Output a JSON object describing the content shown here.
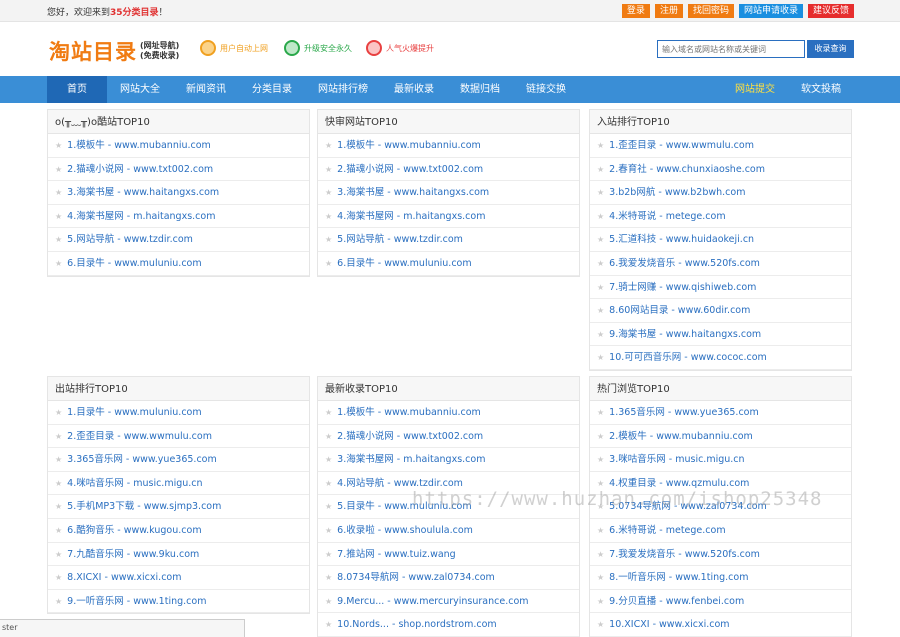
{
  "topbar": {
    "welcome_prefix": "您好，欢迎来到",
    "welcome_brand": "35分类目录",
    "welcome_suffix": "！",
    "links": [
      {
        "label": "登录",
        "color": "orange"
      },
      {
        "label": "注册",
        "color": "orange"
      },
      {
        "label": "找回密码",
        "color": "orange"
      },
      {
        "label": "网站申请收录",
        "color": "blue"
      },
      {
        "label": "建议反馈",
        "color": "red"
      }
    ]
  },
  "header": {
    "logo_main": "淘站目录",
    "logo_sub1": "(网址导航)",
    "logo_sub2": "(免费收录)",
    "features": [
      "用户自动上网",
      "升级安全永久",
      "人气火爆提升"
    ],
    "search_placeholder": "输入域名或网站名称或关键词",
    "search_button": "收录查询"
  },
  "nav": {
    "items": [
      "首页",
      "网站大全",
      "新闻资讯",
      "分类目录",
      "网站排行榜",
      "最新收录",
      "数据归档",
      "链接交换"
    ],
    "right": [
      "网站提交",
      "软文投稿"
    ]
  },
  "panels": [
    {
      "title": "o(╥﹏╥)o酷站TOP10",
      "rows": [
        {
          "name": "1.模板牛",
          "url": "www.mubanniu.com"
        },
        {
          "name": "2.猫魂小说网",
          "url": "www.txt002.com"
        },
        {
          "name": "3.海棠书屋",
          "url": "www.haitangxs.com"
        },
        {
          "name": "4.海棠书屋网",
          "url": "m.haitangxs.com"
        },
        {
          "name": "5.网站导航",
          "url": "www.tzdir.com"
        },
        {
          "name": "6.目录牛",
          "url": "www.muluniu.com"
        }
      ]
    },
    {
      "title": "快审网站TOP10",
      "rows": [
        {
          "name": "1.模板牛",
          "url": "www.mubanniu.com"
        },
        {
          "name": "2.猫魂小说网",
          "url": "www.txt002.com"
        },
        {
          "name": "3.海棠书屋",
          "url": "www.haitangxs.com"
        },
        {
          "name": "4.海棠书屋网",
          "url": "m.haitangxs.com"
        },
        {
          "name": "5.网站导航",
          "url": "www.tzdir.com"
        },
        {
          "name": "6.目录牛",
          "url": "www.muluniu.com"
        }
      ]
    },
    {
      "title": "入站排行TOP10",
      "rows": [
        {
          "name": "1.歪歪目录",
          "url": "www.wwmulu.com"
        },
        {
          "name": "2.春育社",
          "url": "www.chunxiaoshe.com"
        },
        {
          "name": "3.b2b网航",
          "url": "www.b2bwh.com"
        },
        {
          "name": "4.米特哥说",
          "url": "metege.com"
        },
        {
          "name": "5.汇道科技",
          "url": "www.huidaokeji.cn"
        },
        {
          "name": "6.我爱发烧音乐",
          "url": "www.520fs.com"
        },
        {
          "name": "7.骑士网赚",
          "url": "www.qishiweb.com"
        },
        {
          "name": "8.60网站目录",
          "url": "www.60dir.com"
        },
        {
          "name": "9.海棠书屋",
          "url": "www.haitangxs.com"
        },
        {
          "name": "10.可可西音乐网",
          "url": "www.cococ.com"
        }
      ]
    },
    {
      "title": "出站排行TOP10",
      "rows": [
        {
          "name": "1.目录牛",
          "url": "www.muluniu.com"
        },
        {
          "name": "2.歪歪目录",
          "url": "www.wwmulu.com"
        },
        {
          "name": "3.365音乐网",
          "url": "www.yue365.com"
        },
        {
          "name": "4.咪咕音乐网",
          "url": "music.migu.cn"
        },
        {
          "name": "5.手机MP3下载",
          "url": "www.sjmp3.com"
        },
        {
          "name": "6.酷狗音乐",
          "url": "www.kugou.com"
        },
        {
          "name": "7.九酷音乐网",
          "url": "www.9ku.com"
        },
        {
          "name": "8.XICXI",
          "url": "www.xicxi.com"
        },
        {
          "name": "9.一听音乐网",
          "url": "www.1ting.com"
        }
      ]
    },
    {
      "title": "最新收录TOP10",
      "rows": [
        {
          "name": "1.模板牛",
          "url": "www.mubanniu.com"
        },
        {
          "name": "2.猫魂小说网",
          "url": "www.txt002.com"
        },
        {
          "name": "3.海棠书屋网",
          "url": "m.haitangxs.com"
        },
        {
          "name": "4.网站导航",
          "url": "www.tzdir.com"
        },
        {
          "name": "5.目录牛",
          "url": "www.muluniu.com"
        },
        {
          "name": "6.收录啦",
          "url": "www.shoulula.com"
        },
        {
          "name": "7.推站网",
          "url": "www.tuiz.wang"
        },
        {
          "name": "8.0734导航网",
          "url": "www.zal0734.com"
        },
        {
          "name": "9.Mercu...",
          "url": "www.mercuryinsurance.com"
        },
        {
          "name": "10.Nords...",
          "url": "shop.nordstrom.com"
        }
      ]
    },
    {
      "title": "热门浏览TOP10",
      "rows": [
        {
          "name": "1.365音乐网",
          "url": "www.yue365.com"
        },
        {
          "name": "2.模板牛",
          "url": "www.mubanniu.com"
        },
        {
          "name": "3.咪咕音乐网",
          "url": "music.migu.cn"
        },
        {
          "name": "4.权重目录",
          "url": "www.qzmulu.com"
        },
        {
          "name": "5.0734导航网",
          "url": "www.zal0734.com"
        },
        {
          "name": "6.米特哥说",
          "url": "metege.com"
        },
        {
          "name": "7.我爱发烧音乐",
          "url": "www.520fs.com"
        },
        {
          "name": "8.一听音乐网",
          "url": "www.1ting.com"
        },
        {
          "name": "9.分贝直播",
          "url": "www.fenbei.com"
        },
        {
          "name": "10.XICXI",
          "url": "www.xicxi.com"
        }
      ]
    }
  ],
  "watermark": "https://www.huzhan.com/ishop25348",
  "statusbar": "ster",
  "colors": {
    "accent": "#3a8ed6",
    "nav_active": "#1f68b5",
    "link": "#2a6fc0",
    "logo": "#f07b12"
  }
}
